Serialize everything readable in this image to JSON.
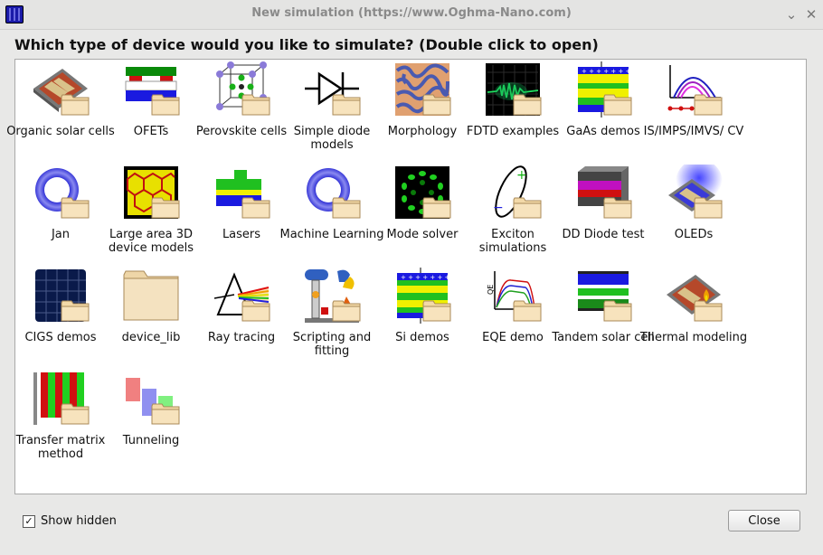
{
  "window": {
    "title": "New simulation (https://www.Oghma-Nano.com)",
    "minimize": "⌄",
    "close": "✕"
  },
  "prompt": "Which type of device would you like to simulate? (Double click to open)",
  "items": [
    {
      "label": "Organic solar cells",
      "icon": "organic-solar-cell-icon"
    },
    {
      "label": "OFETs",
      "icon": "ofet-icon"
    },
    {
      "label": "Perovskite cells",
      "icon": "perovskite-icon"
    },
    {
      "label": "Simple diode models",
      "icon": "diode-icon"
    },
    {
      "label": "Morphology",
      "icon": "morphology-icon"
    },
    {
      "label": "FDTD examples",
      "icon": "fdtd-icon"
    },
    {
      "label": "GaAs demos",
      "icon": "gaas-icon"
    },
    {
      "label": "IS/IMPS/IMVS/ CV",
      "icon": "is-imps-icon"
    },
    {
      "label": "Jan",
      "icon": "ring-icon"
    },
    {
      "label": "Large area 3D device models",
      "icon": "large-area-icon"
    },
    {
      "label": "Lasers",
      "icon": "laser-icon"
    },
    {
      "label": "Machine Learning",
      "icon": "ring-icon"
    },
    {
      "label": "Mode solver",
      "icon": "mode-solver-icon"
    },
    {
      "label": "Exciton simulations",
      "icon": "exciton-icon"
    },
    {
      "label": "DD Diode test",
      "icon": "dd-diode-icon"
    },
    {
      "label": "OLEDs",
      "icon": "oled-icon"
    },
    {
      "label": "CIGS demos",
      "icon": "cigs-icon"
    },
    {
      "label": "device_lib",
      "icon": "folder-icon"
    },
    {
      "label": "Ray tracing",
      "icon": "prism-icon"
    },
    {
      "label": "Scripting and fitting",
      "icon": "scripting-icon"
    },
    {
      "label": "Si demos",
      "icon": "si-icon"
    },
    {
      "label": "EQE demo",
      "icon": "eqe-icon"
    },
    {
      "label": "Tandem solar cell",
      "icon": "tandem-icon"
    },
    {
      "label": "Thermal modeling",
      "icon": "thermal-icon"
    },
    {
      "label": "Transfer matrix method",
      "icon": "transfer-matrix-icon"
    },
    {
      "label": "Tunneling",
      "icon": "tunneling-icon"
    }
  ],
  "footer": {
    "show_hidden_label": "Show hidden",
    "show_hidden_checked": true,
    "close_label": "Close"
  }
}
